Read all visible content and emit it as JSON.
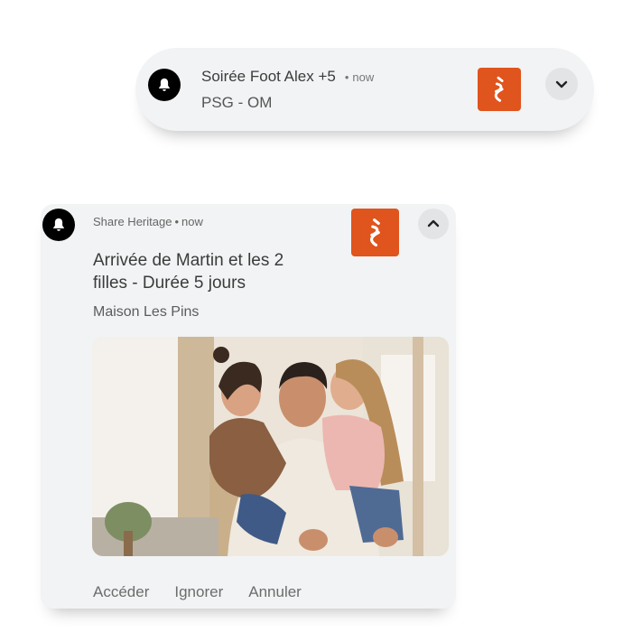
{
  "notification_collapsed": {
    "title": "Soirée Foot Alex +5",
    "separator": "•",
    "time": "now",
    "message": "PSG - OM",
    "icons": {
      "left": "bell-icon",
      "app": "app-logo-icon",
      "toggle": "chevron-down-icon"
    }
  },
  "notification_expanded": {
    "app_name": "Share Heritage",
    "separator": "•",
    "time": "now",
    "title": "Arrivée de Martin et les 2 filles -  Durée 5 jours",
    "message": "Maison Les Pins",
    "image_caption": "Family hug photo",
    "actions": {
      "open": "Accéder",
      "ignore": "Ignorer",
      "cancel": "Annuler"
    },
    "icons": {
      "left": "bell-icon",
      "app": "app-logo-icon",
      "toggle": "chevron-up-icon"
    }
  },
  "colors": {
    "card_bg": "#f1f3f4",
    "app_logo": "#e0541d",
    "bell_bg": "#000000",
    "toggle_bg": "#e2e4e6"
  }
}
